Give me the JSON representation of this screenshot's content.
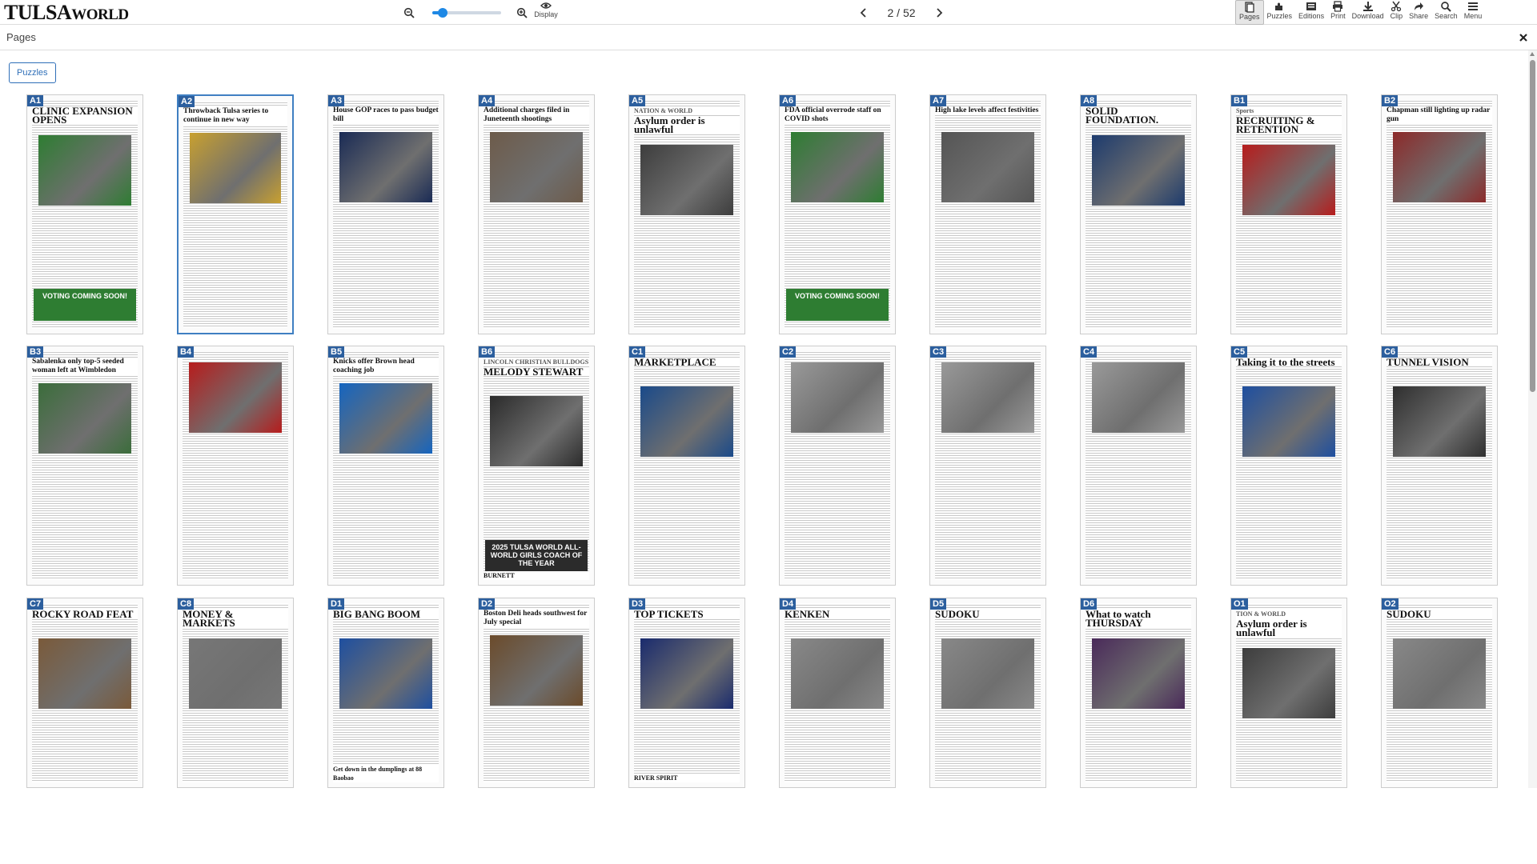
{
  "app": {
    "logo_main": "TULSA",
    "logo_word": "WORLD"
  },
  "toolbar": {
    "display_label": "Display",
    "zoom_level": 0.15,
    "page_indicator": "2 / 52",
    "tools": [
      {
        "label": "Pages",
        "icon": "pages-icon",
        "active": true
      },
      {
        "label": "Puzzles",
        "icon": "puzzle-icon",
        "active": false
      },
      {
        "label": "Editions",
        "icon": "editions-icon",
        "active": false
      },
      {
        "label": "Print",
        "icon": "print-icon",
        "active": false
      },
      {
        "label": "Download",
        "icon": "download-icon",
        "active": false
      },
      {
        "label": "Clip",
        "icon": "scissors-icon",
        "active": false
      },
      {
        "label": "Share",
        "icon": "share-icon",
        "active": false
      },
      {
        "label": "Search",
        "icon": "search-icon",
        "active": false
      },
      {
        "label": "Menu",
        "icon": "menu-icon",
        "active": false
      }
    ]
  },
  "panel": {
    "title": "Pages",
    "puzzles_button": "Puzzles",
    "selected_page": "A2"
  },
  "pages": [
    {
      "id": "A1",
      "headline": "CLINIC EXPANSION OPENS",
      "banner": "VOTING COMING SOON!",
      "accent": "#2e7d32"
    },
    {
      "id": "A2",
      "headline": "Throwback Tulsa series to continue in new way",
      "accent": "#c8a030"
    },
    {
      "id": "A3",
      "headline": "House GOP races to pass budget bill",
      "accent": "#1a2b55"
    },
    {
      "id": "A4",
      "headline": "Additional charges filed in Juneteenth shootings",
      "accent": "#6d5b4a"
    },
    {
      "id": "A5",
      "headline": "Asylum order is unlawful",
      "kicker": "NATION & WORLD",
      "accent": "#3d3d3d"
    },
    {
      "id": "A6",
      "headline": "FDA official overrode staff on COVID shots",
      "banner": "VOTING COMING SOON!",
      "accent": "#2e7d32"
    },
    {
      "id": "A7",
      "headline": "High lake levels affect festivities",
      "accent": "#555"
    },
    {
      "id": "A8",
      "headline": "SOLID FOUNDATION.",
      "accent": "#1d3b6e"
    },
    {
      "id": "B1",
      "headline": "RECRUITING & RETENTION",
      "kicker": "Sports",
      "accent": "#b71c1c"
    },
    {
      "id": "B2",
      "headline": "Chapman still lighting up radar gun",
      "accent": "#8c2a2a"
    },
    {
      "id": "B3",
      "headline": "Sabalenka only top-5 seeded woman left at Wimbledon",
      "accent": "#3b6d3b"
    },
    {
      "id": "B4",
      "headline": "",
      "accent": "#b71c1c"
    },
    {
      "id": "B5",
      "headline": "Knicks offer Brown head coaching job",
      "accent": "#1565c0"
    },
    {
      "id": "B6",
      "headline": "MELODY STEWART",
      "kicker": "LINCOLN CHRISTIAN BULLDOGS",
      "banner": "2025 TULSA WORLD ALL-WORLD GIRLS COACH OF THE YEAR",
      "footer": "BURNETT",
      "accent": "#2b2b2b"
    },
    {
      "id": "C1",
      "headline": "MARKETPLACE",
      "accent": "#1a4a8a"
    },
    {
      "id": "C2",
      "headline": "",
      "accent": "#999"
    },
    {
      "id": "C3",
      "headline": "",
      "accent": "#999"
    },
    {
      "id": "C4",
      "headline": "",
      "accent": "#999"
    },
    {
      "id": "C5",
      "headline": "Taking it to the streets",
      "accent": "#1e4fa0"
    },
    {
      "id": "C6",
      "headline": "TUNNEL VISION",
      "accent": "#2f2f2f"
    },
    {
      "id": "C7",
      "headline": "ROCKY ROAD FEAT",
      "accent": "#7a5a3a"
    },
    {
      "id": "C8",
      "headline": "MONEY & MARKETS",
      "accent": "#777"
    },
    {
      "id": "D1",
      "headline": "BIG BANG BOOM",
      "footer": "Get down in the dumplings at 88 Baobao",
      "accent": "#1e4fa0"
    },
    {
      "id": "D2",
      "headline": "Boston Deli heads southwest for July special",
      "accent": "#6b4b2b"
    },
    {
      "id": "D3",
      "headline": "TOP TICKETS",
      "footer": "RIVER SPIRIT",
      "accent": "#1a2b6e"
    },
    {
      "id": "D4",
      "headline": "KENKEN",
      "accent": "#888"
    },
    {
      "id": "D5",
      "headline": "SUDOKU",
      "accent": "#888"
    },
    {
      "id": "D6",
      "headline": "What to watch THURSDAY",
      "accent": "#4a2a5a"
    },
    {
      "id": "O1",
      "headline": "Asylum order is unlawful",
      "kicker": "TION & WORLD",
      "accent": "#3d3d3d"
    },
    {
      "id": "O2",
      "headline": "SUDOKU",
      "accent": "#888"
    }
  ]
}
